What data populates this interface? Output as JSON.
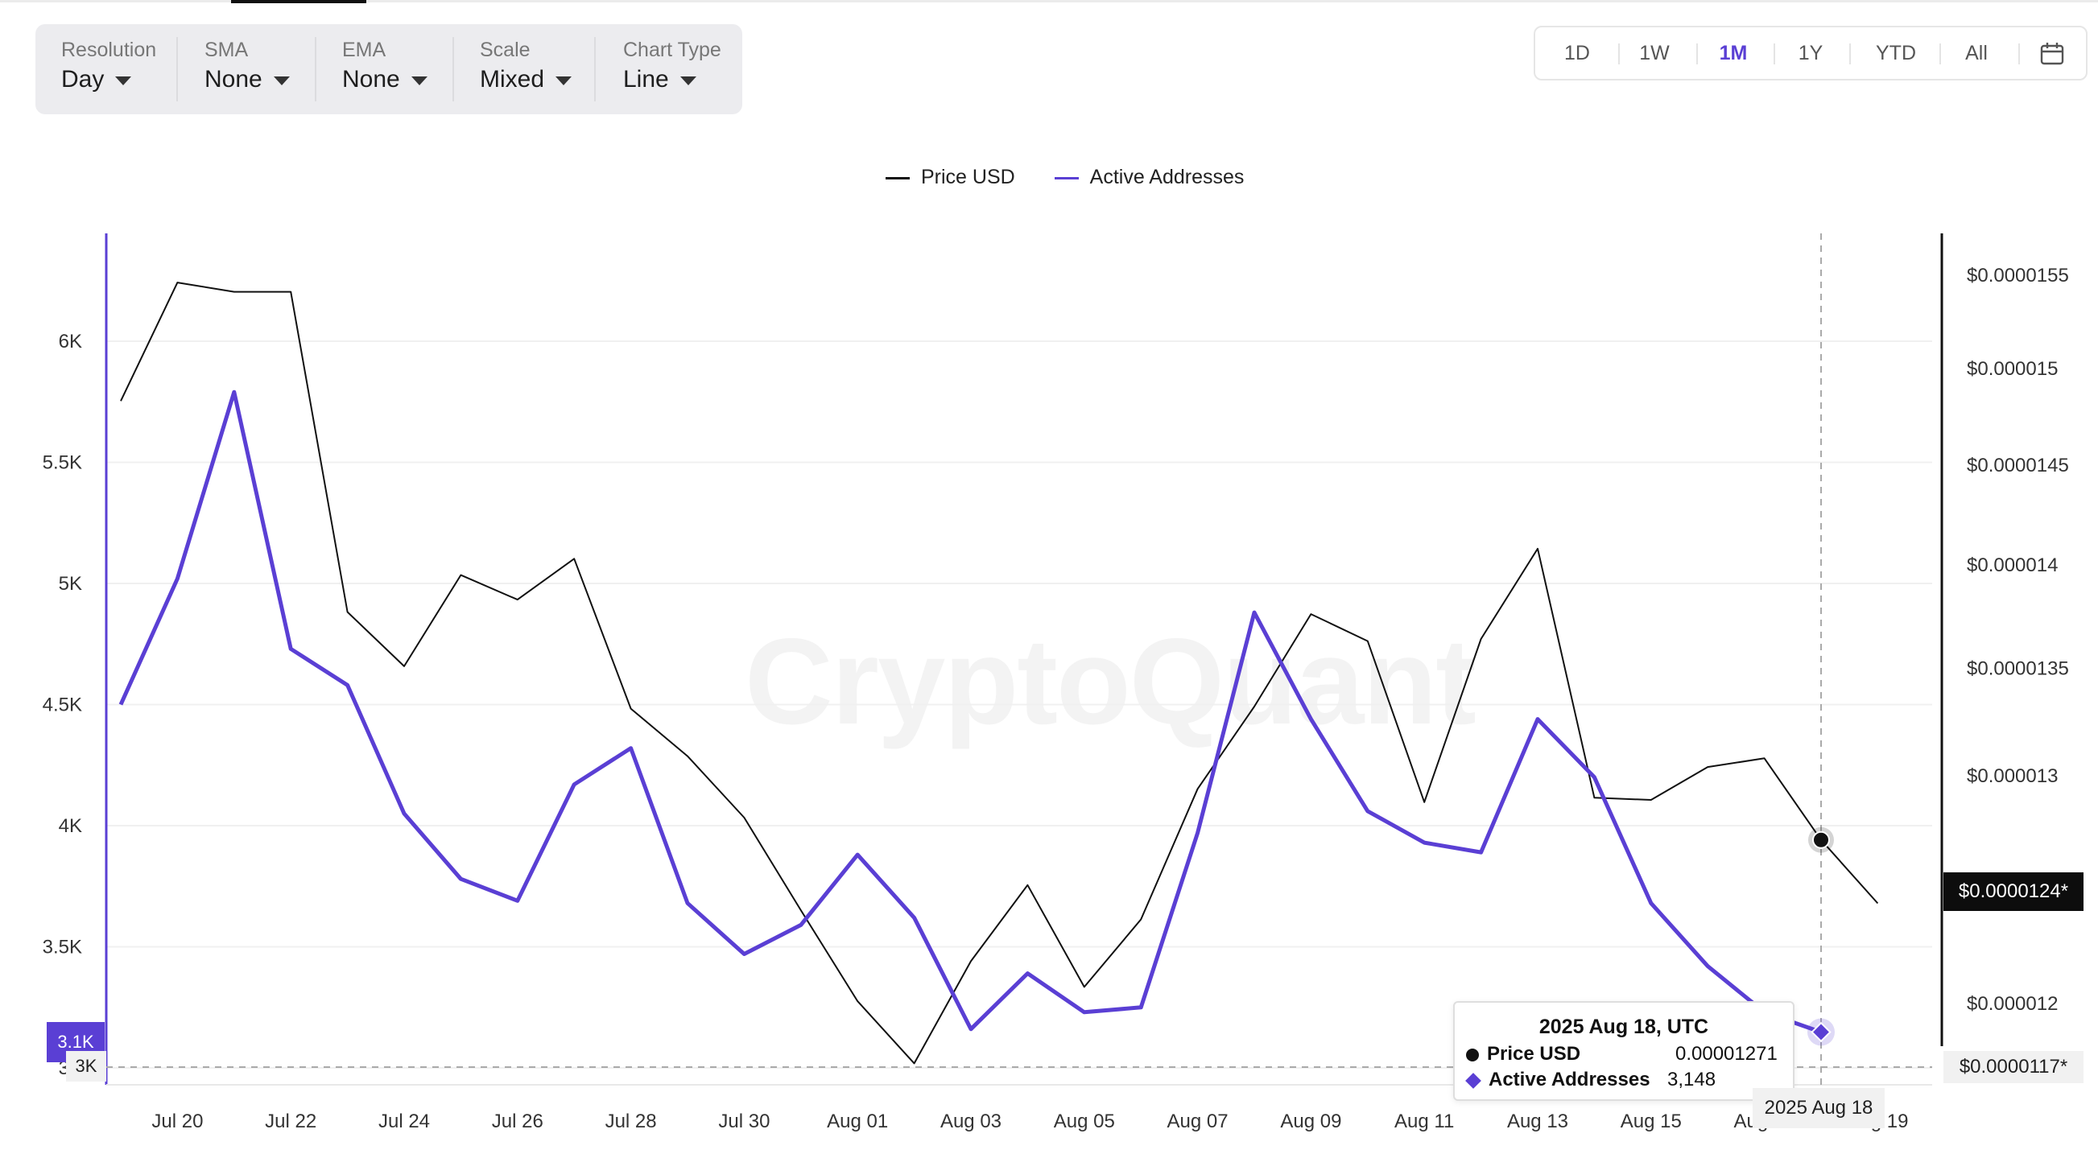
{
  "controls": [
    {
      "label": "Resolution",
      "value": "Day"
    },
    {
      "label": "SMA",
      "value": "None"
    },
    {
      "label": "EMA",
      "value": "None"
    },
    {
      "label": "Scale",
      "value": "Mixed"
    },
    {
      "label": "Chart Type",
      "value": "Line"
    }
  ],
  "ranges": [
    "1D",
    "1W",
    "1M",
    "1Y",
    "YTD",
    "All"
  ],
  "active_range": "1M",
  "calendar_icon": "calendar-icon",
  "watermark": "CryptoQuant",
  "colors": {
    "price": "#111111",
    "active_addresses": "#5a3fd4",
    "accent": "#5a3fd4"
  },
  "badges": {
    "price_current": "$0.0000124*",
    "price_cursor": "$0.0000117*",
    "aa_current": "3.1K",
    "aa_cursor": "3K",
    "date_cursor": "2025 Aug 18"
  },
  "tooltip": {
    "title": "2025 Aug 18, UTC",
    "price_label": "Price USD",
    "price_value": "0.00001271",
    "aa_label": "Active Addresses",
    "aa_value": "3,148"
  },
  "chart_data": {
    "type": "line",
    "x": [
      "Jul 19",
      "Jul 20",
      "Jul 21",
      "Jul 22",
      "Jul 23",
      "Jul 24",
      "Jul 25",
      "Jul 26",
      "Jul 27",
      "Jul 28",
      "Jul 29",
      "Jul 30",
      "Jul 31",
      "Aug 01",
      "Aug 02",
      "Aug 03",
      "Aug 04",
      "Aug 05",
      "Aug 06",
      "Aug 07",
      "Aug 08",
      "Aug 09",
      "Aug 10",
      "Aug 11",
      "Aug 12",
      "Aug 13",
      "Aug 14",
      "Aug 15",
      "Aug 16",
      "Aug 17",
      "Aug 18",
      "Aug 19"
    ],
    "x_tick_labels": [
      "Jul 20",
      "Jul 22",
      "Jul 24",
      "Jul 26",
      "Jul 28",
      "Jul 30",
      "Aug 01",
      "Aug 03",
      "Aug 05",
      "Aug 07",
      "Aug 09",
      "Aug 11",
      "Aug 13",
      "Aug 15",
      "Aug 17",
      "Aug 19"
    ],
    "series": [
      {
        "name": "Price USD",
        "axis": "right",
        "values": [
          1.483e-05,
          1.546e-05,
          1.541e-05,
          1.541e-05,
          1.377e-05,
          1.351e-05,
          1.395e-05,
          1.383e-05,
          1.403e-05,
          1.331e-05,
          1.309e-05,
          1.281e-05,
          1.24e-05,
          1.201e-05,
          1.175e-05,
          1.218e-05,
          1.251e-05,
          1.207e-05,
          1.236e-05,
          1.294e-05,
          1.332e-05,
          1.376e-05,
          1.363e-05,
          1.288e-05,
          1.364e-05,
          1.408e-05,
          1.29e-05,
          1.289e-05,
          1.304e-05,
          1.308e-05,
          1.271e-05,
          1.243e-05
        ]
      },
      {
        "name": "Active Addresses",
        "axis": "left",
        "values": [
          4500,
          5020,
          5790,
          4730,
          4580,
          4050,
          3780,
          3690,
          4170,
          4320,
          3680,
          3470,
          3590,
          3880,
          3620,
          3160,
          3390,
          3230,
          3250,
          3970,
          4880,
          4440,
          4060,
          3930,
          3890,
          4440,
          4200,
          3680,
          3420,
          3230,
          3148,
          null
        ]
      }
    ],
    "left_axis": {
      "ticks": [
        "3K",
        "3.5K",
        "4K",
        "4.5K",
        "5K",
        "5.5K",
        "6K"
      ],
      "min": 3000,
      "max": 6000
    },
    "right_axis": {
      "ticks": [
        "$0.000012",
        "$0.000013",
        "$0.0000135",
        "$0.000014",
        "$0.0000145",
        "$0.000015",
        "$0.0000155"
      ],
      "tick_values": [
        1.2e-05,
        1.3e-05,
        1.35e-05,
        1.4e-05,
        1.45e-05,
        1.5e-05,
        1.55e-05
      ],
      "scale": "log"
    },
    "legend": [
      "Price USD",
      "Active Addresses"
    ],
    "legend_position": "top-center",
    "grid": true,
    "hovered": "Aug 18"
  }
}
